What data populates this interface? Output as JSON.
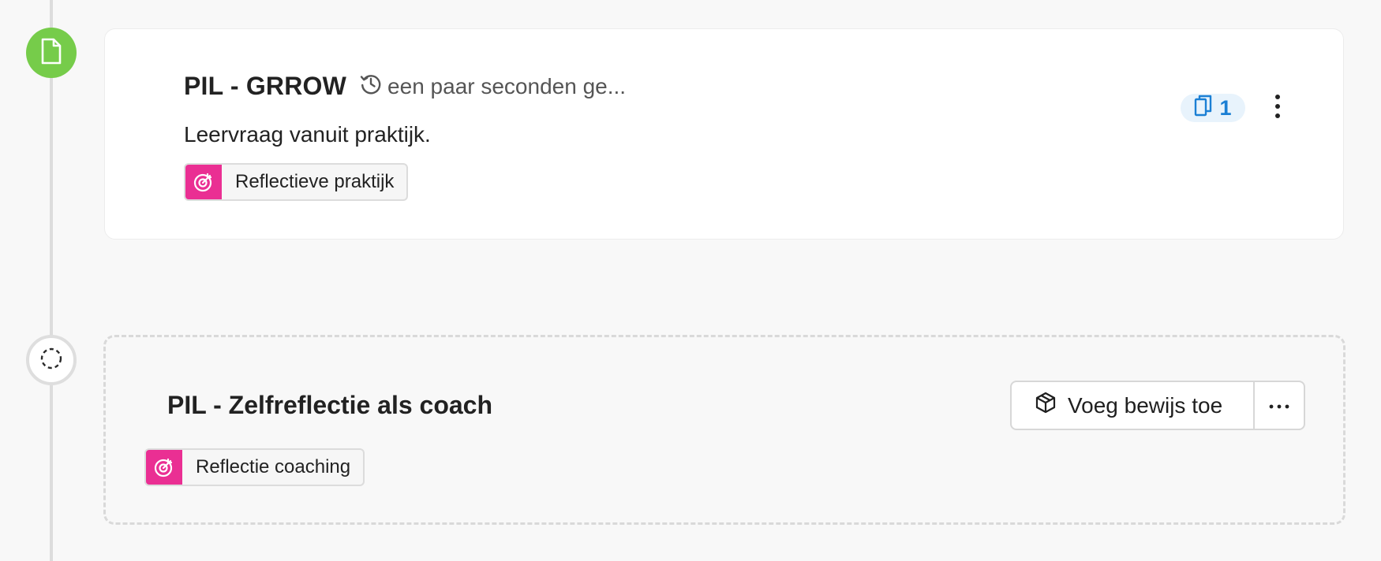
{
  "timeline": {
    "items": [
      {
        "status": "completed",
        "node_icon": "document-icon",
        "node_color": "#76cc4a",
        "title": "PIL - GRROW",
        "updated": "een paar seconden ge...",
        "updated_icon": "history-icon",
        "description": "Leervraag vanuit praktijk.",
        "tag": {
          "label": "Reflectieve praktijk",
          "icon": "target-icon",
          "color": "#ea2f93"
        },
        "attachments": {
          "icon": "copy-icon",
          "count": "1",
          "color": "#1b7fd4"
        },
        "menu_icon": "kebab-vertical-icon"
      },
      {
        "status": "pending",
        "node_icon": "dashed-circle-icon",
        "title": "PIL - Zelfreflectie als coach",
        "tag": {
          "label": "Reflectie coaching",
          "icon": "target-icon",
          "color": "#ea2f93"
        },
        "add_evidence_label": "Voeg bewijs toe",
        "add_evidence_icon": "box-icon",
        "more_icon": "ellipsis-icon"
      }
    ]
  }
}
